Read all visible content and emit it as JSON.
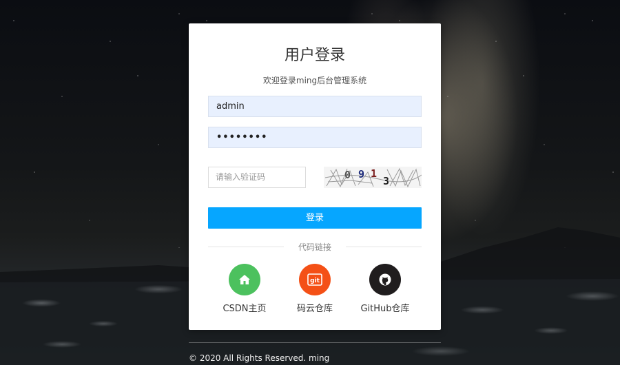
{
  "login": {
    "title": "用户登录",
    "subtitle": "欢迎登录ming后台管理系统",
    "username_value": "admin",
    "password_value": "••••••••",
    "captcha_placeholder": "请输入验证码",
    "captcha_text": "0913",
    "submit_label": "登录"
  },
  "links": {
    "divider_label": "代码链接",
    "items": [
      {
        "label": "CSDN主页",
        "icon": "home-icon",
        "color": "#4cc15e"
      },
      {
        "label": "码云仓库",
        "icon": "git-icon",
        "color": "#f45016"
      },
      {
        "label": "GitHub仓库",
        "icon": "github-icon",
        "color": "#201d1e"
      }
    ]
  },
  "footer": {
    "copyright": "© 2020 All Rights Reserved. ming"
  },
  "colors": {
    "primary": "#06a6ff",
    "input_autofill": "#e8f0fe"
  }
}
